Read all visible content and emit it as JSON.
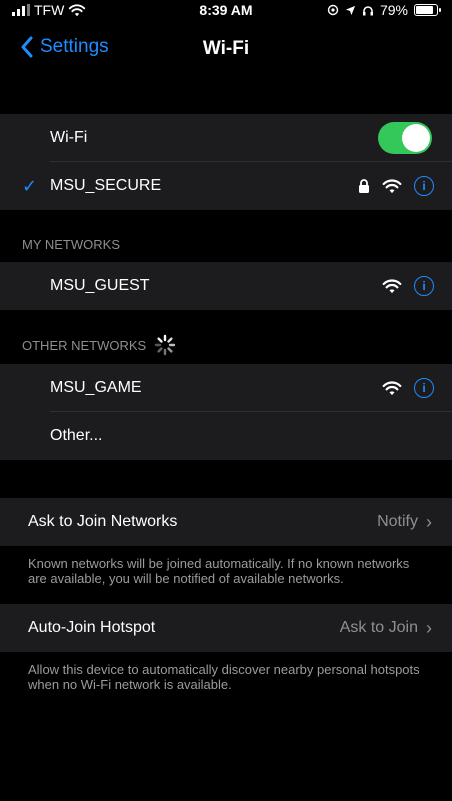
{
  "status_bar": {
    "carrier": "TFW",
    "time": "8:39 AM",
    "battery_percent": "79%",
    "battery_level": 0.79
  },
  "nav": {
    "back_label": "Settings",
    "title": "Wi-Fi"
  },
  "wifi": {
    "label": "Wi-Fi",
    "enabled": true,
    "connected_network": "MSU_SECURE"
  },
  "my_networks": {
    "header": "MY NETWORKS",
    "items": [
      {
        "name": "MSU_GUEST"
      }
    ]
  },
  "other_networks": {
    "header": "OTHER NETWORKS",
    "items": [
      {
        "name": "MSU_GAME"
      },
      {
        "name": "Other..."
      }
    ]
  },
  "ask_to_join": {
    "label": "Ask to Join Networks",
    "value": "Notify",
    "footnote": "Known networks will be joined automatically. If no known networks are available, you will be notified of available networks."
  },
  "auto_join_hotspot": {
    "label": "Auto-Join Hotspot",
    "value": "Ask to Join",
    "footnote": "Allow this device to automatically discover nearby personal hotspots when no Wi-Fi network is available."
  },
  "colors": {
    "accent": "#1e8cff",
    "toggle_on": "#34c759",
    "cell_bg": "#1c1c1e",
    "secondary_text": "#8e8e93"
  }
}
